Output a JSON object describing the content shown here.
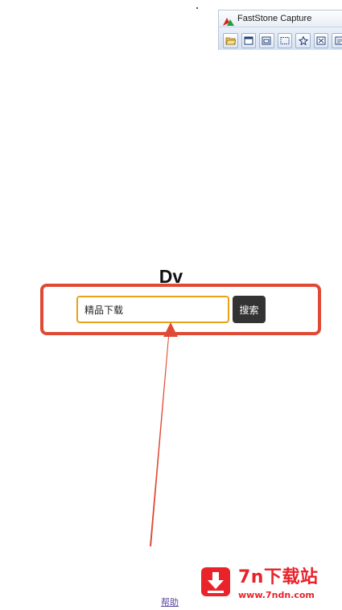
{
  "capture_tool": {
    "title": "FastStone Capture",
    "tools": [
      "open-folder-icon",
      "capture-window-icon",
      "capture-object-icon",
      "capture-rectangle-icon",
      "capture-freehand-icon",
      "capture-fullscreen-icon",
      "capture-scroll-icon"
    ]
  },
  "site": {
    "title": "Dv"
  },
  "search": {
    "value": "精品下载",
    "button_label": "搜索"
  },
  "footer": {
    "help_link": "帮助"
  },
  "watermark": {
    "name": "7n下载站",
    "url": "www.7ndn.com"
  },
  "colors": {
    "highlight": "#e04a35",
    "input_border": "#e8a317",
    "button_bg": "#333333",
    "watermark": "#e8232a"
  }
}
